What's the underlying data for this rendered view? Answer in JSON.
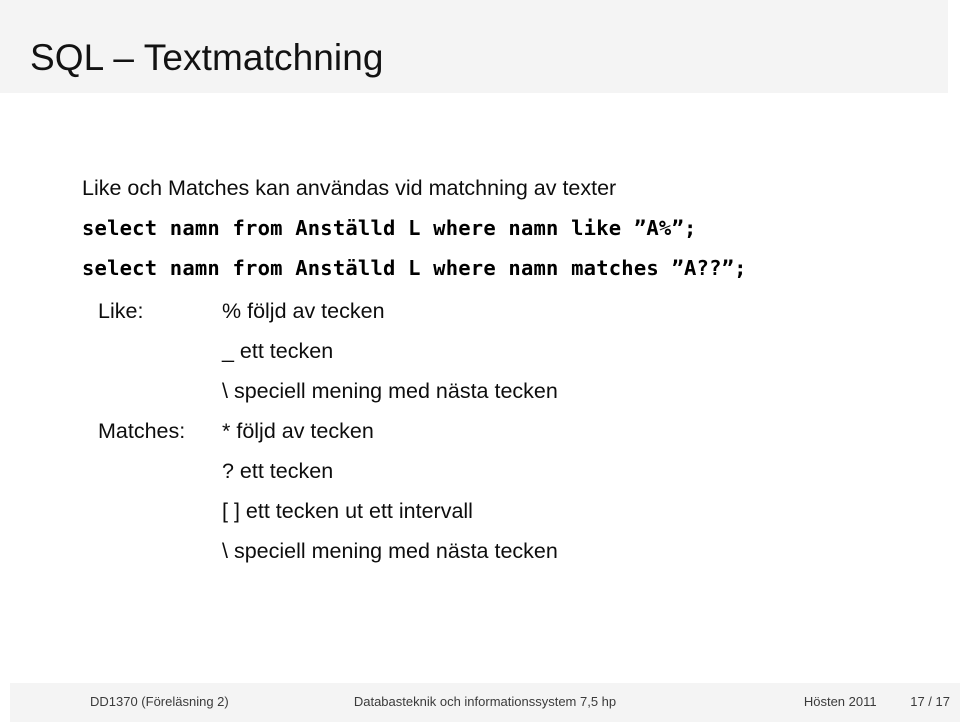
{
  "header": {
    "title": "SQL – Textmatchning",
    "band_color": "#f4f4f4"
  },
  "main": {
    "intro": "Like och Matches kan användas vid matchning av texter",
    "sql_statements": [
      "select namn from Anställd L where namn like ”A%”;",
      "select namn from Anställd L where namn matches ”A??”;"
    ],
    "definitions": [
      {
        "label": "Like:",
        "desc": "% följd av tecken"
      },
      {
        "label": "",
        "desc": "_ ett tecken"
      },
      {
        "label": "",
        "desc": "\\ speciell mening med nästa tecken"
      },
      {
        "label": "Matches:",
        "desc": "* följd av tecken"
      },
      {
        "label": "",
        "desc": "? ett tecken"
      },
      {
        "label": "",
        "desc": "[ ] ett tecken ut ett intervall"
      },
      {
        "label": "",
        "desc": "\\ speciell mening med nästa tecken"
      }
    ]
  },
  "footer": {
    "left": "DD1370  (Föreläsning 2)",
    "center": "Databasteknik och informationssystem 7,5 hp",
    "term": "Hösten 2011",
    "page": "17 / 17",
    "band_color": "#f4f4f4"
  }
}
